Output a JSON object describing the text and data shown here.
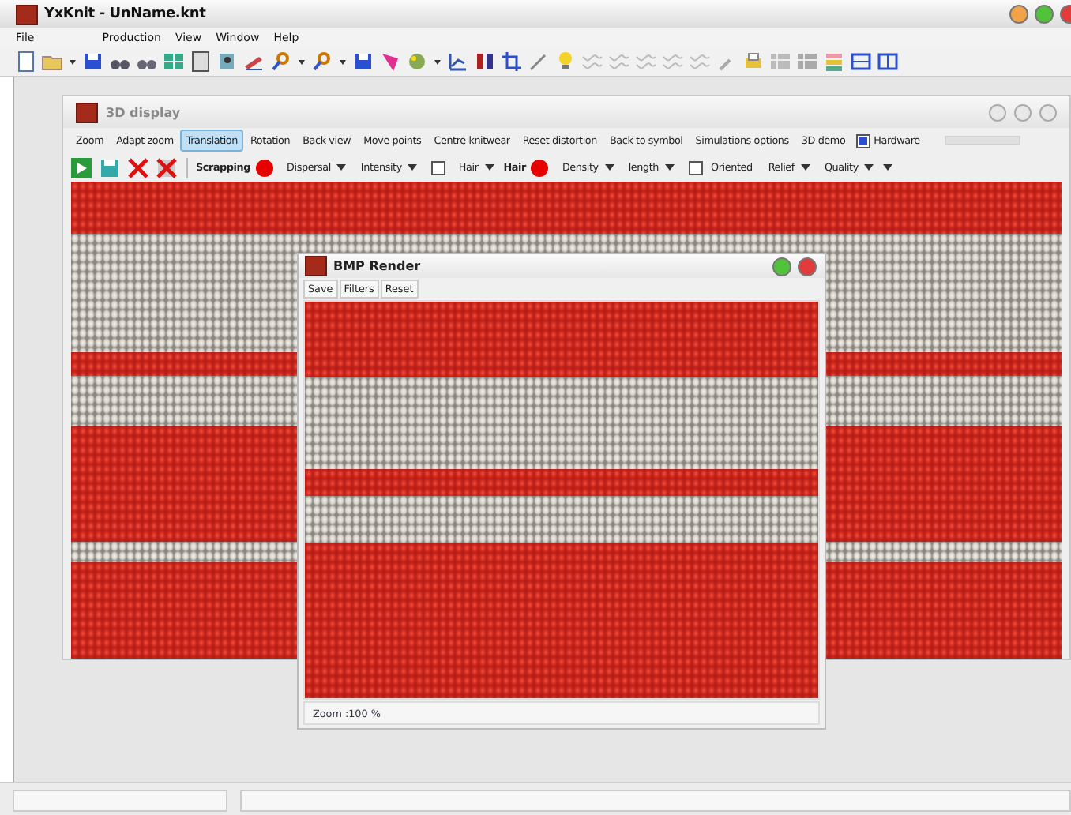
{
  "window": {
    "title": "YxKnit - UnName.knt"
  },
  "menu": [
    {
      "label": "File",
      "disabled": false
    },
    {
      "label": "Production",
      "disabled": false
    },
    {
      "label": "View",
      "disabled": false
    },
    {
      "label": "Window",
      "disabled": false
    },
    {
      "label": "Help",
      "disabled": false
    }
  ],
  "display_window": {
    "title": "3D display",
    "options": [
      {
        "kind": "tab",
        "label": "Zoom",
        "selected": false
      },
      {
        "kind": "tab",
        "label": "Adapt zoom",
        "selected": false
      },
      {
        "kind": "tab",
        "label": "Translation",
        "selected": true
      },
      {
        "kind": "tab",
        "label": "Rotation",
        "selected": false
      },
      {
        "kind": "tab",
        "label": "Back view",
        "selected": false
      },
      {
        "kind": "tab",
        "label": "Move points",
        "selected": false
      },
      {
        "kind": "tab",
        "label": "Centre knitwear",
        "selected": false
      },
      {
        "kind": "tab",
        "label": "Reset distortion",
        "selected": false
      },
      {
        "kind": "tab",
        "label": "Back to symbol",
        "selected": false
      },
      {
        "kind": "tab",
        "label": "Simulations options",
        "selected": false
      },
      {
        "kind": "tab",
        "label": "3D demo",
        "selected": false
      },
      {
        "kind": "check",
        "label": "Hardware",
        "checked": true
      }
    ],
    "settings": [
      {
        "kind": "dot",
        "label": "Scrapping",
        "color": "#e80000"
      },
      {
        "kind": "dropdown",
        "label": "Dispersal"
      },
      {
        "kind": "dropdown",
        "label": "Intensity"
      },
      {
        "kind": "checkdrop",
        "label": "Hair",
        "checked": false
      },
      {
        "kind": "dot",
        "label": "Hair",
        "color": "#e80000"
      },
      {
        "kind": "dropdown",
        "label": "Density"
      },
      {
        "kind": "dropdown",
        "label": "length"
      },
      {
        "kind": "check",
        "label": "Oriented",
        "checked": false
      },
      {
        "kind": "dropdown",
        "label": "Relief"
      },
      {
        "kind": "dropdown",
        "label": "Quality"
      },
      {
        "kind": "caret"
      }
    ]
  },
  "render_window": {
    "title": "BMP Render",
    "tabs": [
      "Save",
      "Filters",
      "Reset"
    ],
    "status": "Zoom :100 %"
  }
}
